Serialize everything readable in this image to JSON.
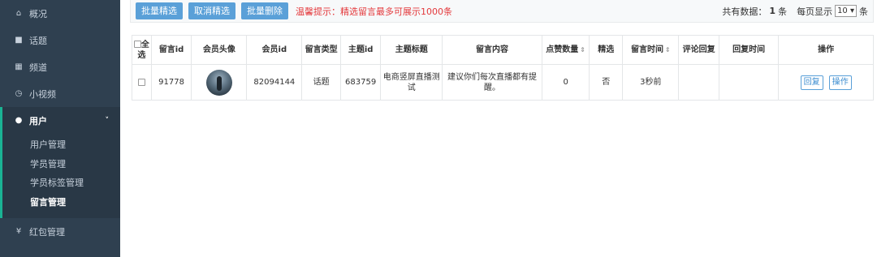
{
  "sidebar": {
    "items": [
      {
        "icon": "home-icon",
        "glyph": "🏠",
        "label": "概况"
      },
      {
        "icon": "video-icon",
        "glyph": "■",
        "label": "话题"
      },
      {
        "icon": "grid-icon",
        "glyph": "▦",
        "label": "频道"
      },
      {
        "icon": "clock-icon",
        "glyph": "◷",
        "label": "小视频"
      }
    ],
    "active": {
      "icon": "user-icon",
      "glyph": "👤",
      "label": "用户",
      "chevron": "˅"
    },
    "sub_items": [
      "用户管理",
      "学员管理",
      "学员标签管理",
      "留言管理"
    ],
    "bottom": {
      "icon": "yen-icon",
      "glyph": "¥",
      "label": "红包管理"
    }
  },
  "toolbar": {
    "batch_select": "批量精选",
    "cancel_select": "取消精选",
    "batch_delete": "批量删除",
    "tip": "温馨提示：精选留言最多可展示1000条",
    "total_prefix": "共有数据：",
    "total_count": "1",
    "total_suffix": "条",
    "per_page_prefix": "每页显示",
    "per_page_value": "10 ▾",
    "per_page_suffix": "条"
  },
  "table": {
    "headers": [
      "全选",
      "留言id",
      "会员头像",
      "会员id",
      "留言类型",
      "主题id",
      "主题标题",
      "留言内容",
      "点赞数量",
      "精选",
      "留言时间",
      "评论回复",
      "回复时间",
      "操作"
    ],
    "sort_glyph": "⇕",
    "row": {
      "msg_id": "91778",
      "member_id": "82094144",
      "type": "话题",
      "topic_id": "683759",
      "topic_title": "电商竖屏直播测试",
      "content": "建议你们每次直播都有提醒。",
      "likes": "0",
      "featured": "否",
      "time": "3秒前",
      "reply": "",
      "reply_time": "",
      "op_reply": "回复",
      "op_action": "操作"
    }
  },
  "colors": {
    "sidebar_bg": "#2f4050",
    "accent": "#1ab394",
    "button": "#5aa0d8",
    "tip": "#e4393c",
    "arrow": "#e8322d"
  }
}
